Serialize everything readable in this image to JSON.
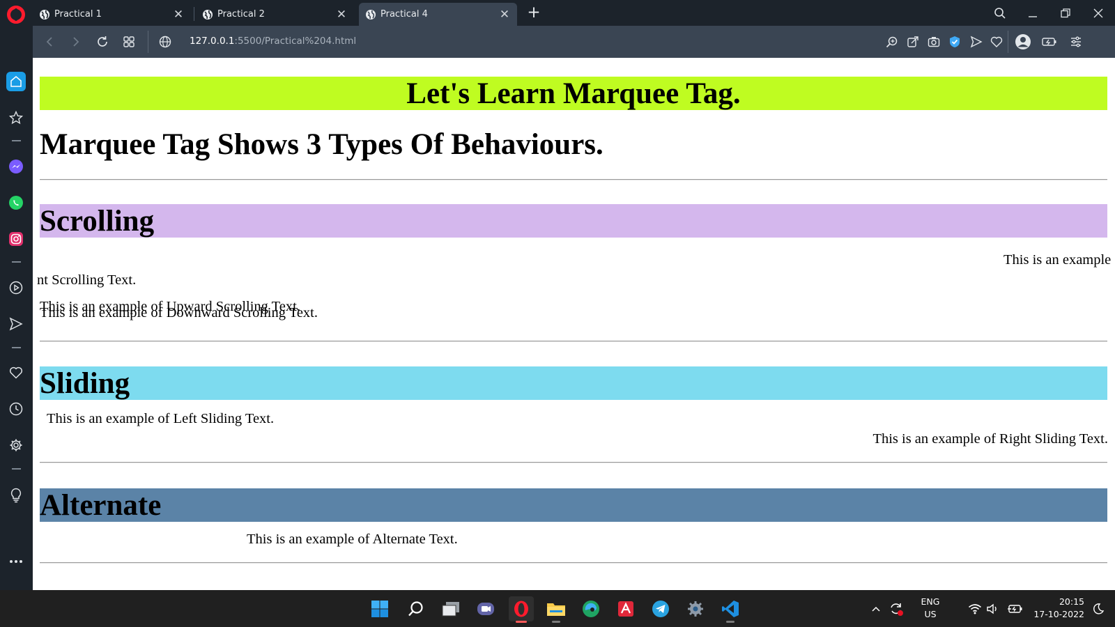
{
  "browser": {
    "tabs": [
      {
        "title": "Practical 1",
        "active": false
      },
      {
        "title": "Practical 2",
        "active": false
      },
      {
        "title": "Practical 4",
        "active": true
      }
    ],
    "url_host": "127.0.0.1",
    "url_path": ":5500/Practical%204.html"
  },
  "page": {
    "title": "Let's Learn Marquee Tag.",
    "subtitle": "Marquee Tag Shows 3 Types Of Behaviours.",
    "scrolling": {
      "heading": "Scrolling",
      "left_text": "This is an example of Left Scrolling Text.",
      "right_text_fragment": "nt Scrolling Text.",
      "upward_text": "This is an example of Upward Scrolling Text.",
      "downward_text": "This is an example of Downward Scrolling Text."
    },
    "sliding": {
      "heading": "Sliding",
      "left_text": "This is an example of Left Sliding Text.",
      "right_text": "This is an example of Right Sliding Text."
    },
    "alternate": {
      "heading": "Alternate",
      "text": "This is an example of Alternate Text."
    },
    "colors": {
      "title_bg": "#bffc21",
      "scrolling_bg": "#d4b7ed",
      "sliding_bg": "#7ddbef",
      "alternate_bg": "#5b83a7"
    }
  },
  "taskbar": {
    "language": "ENG",
    "region": "US",
    "time": "20:15",
    "date": "17-10-2022"
  }
}
